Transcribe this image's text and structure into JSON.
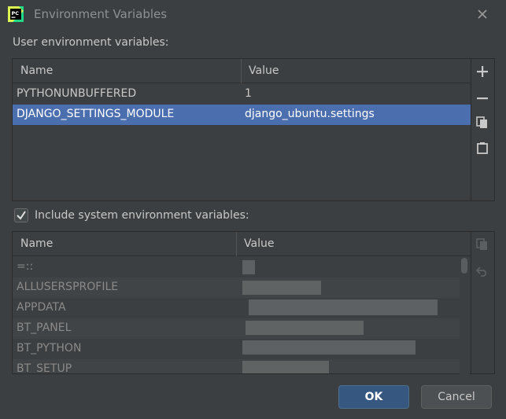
{
  "window": {
    "title": "Environment Variables",
    "app_icon_text": "PC"
  },
  "user_vars": {
    "label": "User environment variables:",
    "columns": [
      "Name",
      "Value"
    ],
    "rows": [
      {
        "name": "PYTHONUNBUFFERED",
        "value": "1",
        "selected": false
      },
      {
        "name": "DJANGO_SETTINGS_MODULE",
        "value": "django_ubuntu.settings",
        "selected": true
      }
    ],
    "toolbar": [
      "add-icon",
      "remove-icon",
      "copy-icon",
      "paste-icon"
    ]
  },
  "system_vars": {
    "checkbox_label": "Include system environment variables:",
    "checked": true,
    "columns": [
      "Name",
      "Value"
    ],
    "rows": [
      {
        "name": "=::"
      },
      {
        "name": "ALLUSERSPROFILE"
      },
      {
        "name": "APPDATA"
      },
      {
        "name": "BT_PANEL"
      },
      {
        "name": "BT_PYTHON"
      },
      {
        "name": "BT_SETUP"
      }
    ],
    "toolbar": [
      "copy-icon",
      "undo-icon"
    ]
  },
  "buttons": {
    "ok": "OK",
    "cancel": "Cancel"
  },
  "colors": {
    "background": "#3c3f41",
    "selection": "#4b6eaf",
    "ok_button": "#365880"
  }
}
